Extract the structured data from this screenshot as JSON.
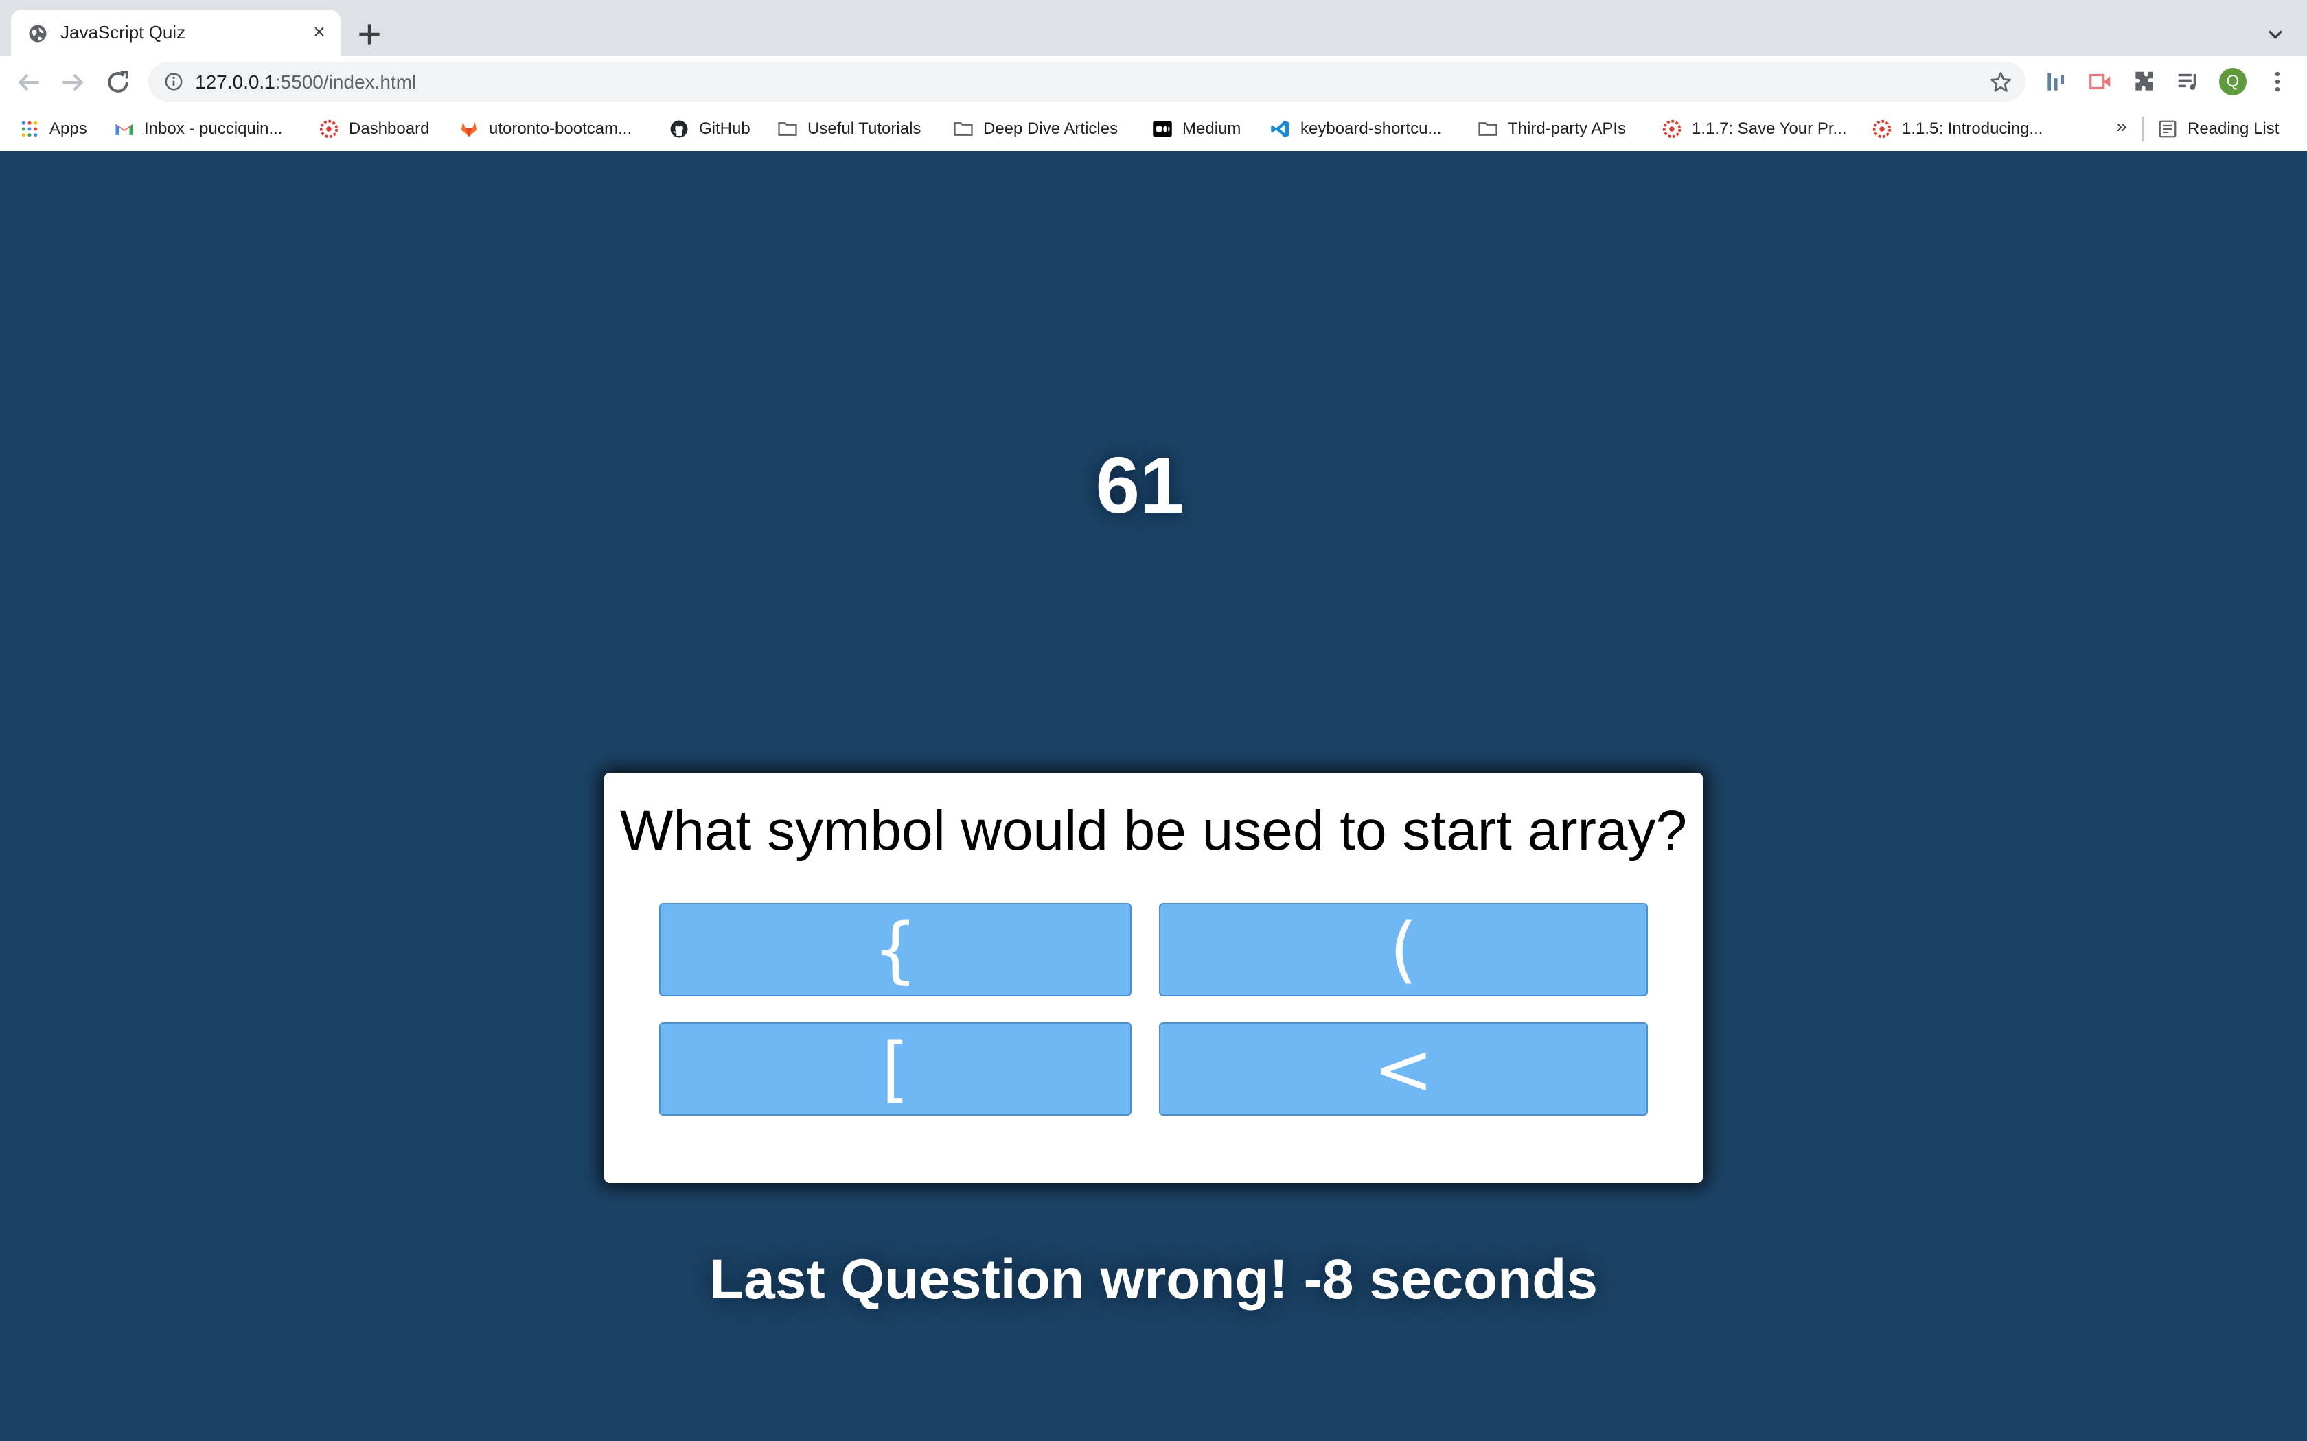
{
  "browser": {
    "tab_title": "JavaScript Quiz",
    "close_glyph": "×",
    "url_host": "127.0.0.1",
    "url_path": ":5500/index.html",
    "avatar_letter": "Q",
    "bookmarks_more": "»",
    "bookmarks": [
      {
        "label": "Apps",
        "icon": "apps-grid-icon"
      },
      {
        "label": "Inbox - pucciquin...",
        "icon": "gmail-icon"
      },
      {
        "label": "Dashboard",
        "icon": "canvas-icon"
      },
      {
        "label": "utoronto-bootcam...",
        "icon": "gitlab-icon"
      },
      {
        "label": "GitHub",
        "icon": "github-icon"
      },
      {
        "label": "Useful Tutorials",
        "icon": "folder-icon"
      },
      {
        "label": "Deep Dive Articles",
        "icon": "folder-icon"
      },
      {
        "label": "Medium",
        "icon": "medium-icon"
      },
      {
        "label": "keyboard-shortcu...",
        "icon": "vscode-icon"
      },
      {
        "label": "Third-party APIs",
        "icon": "folder-icon"
      },
      {
        "label": "1.1.7: Save Your Pr...",
        "icon": "canvas-icon"
      },
      {
        "label": "1.1.5: Introducing...",
        "icon": "canvas-icon"
      }
    ],
    "reading_list": "Reading List"
  },
  "quiz": {
    "timer": "61",
    "question": "What symbol would be used to start array?",
    "answers": [
      "{",
      "(",
      "[",
      "<"
    ],
    "feedback": "Last Question wrong! -8 seconds"
  },
  "colors": {
    "page_background": "#1b4264",
    "answer_button": "#6fb7f5",
    "card": "#ffffff"
  }
}
